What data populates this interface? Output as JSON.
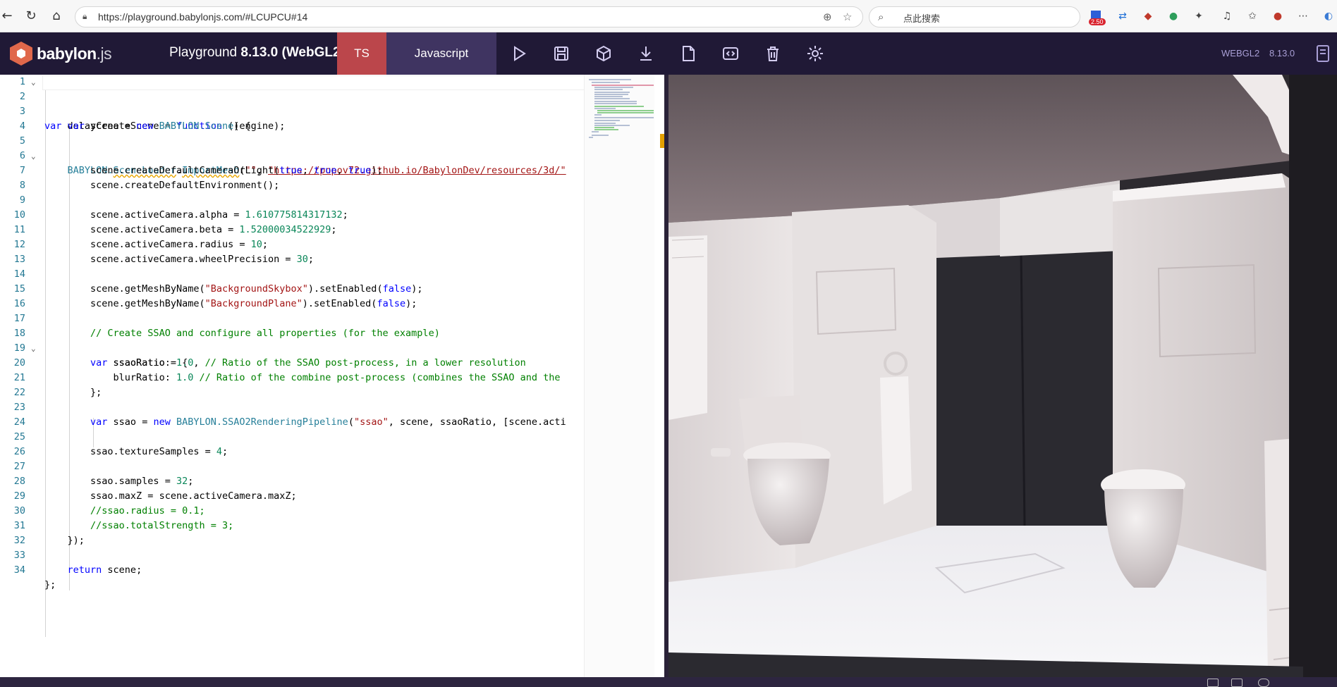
{
  "browser": {
    "url": "https://playground.babylonjs.com/#LCUPCU#14",
    "search_placeholder": "点此搜索",
    "badge": "2.50"
  },
  "app": {
    "logo_main": "babylon",
    "logo_suffix": ".js",
    "title_prefix": "Playground ",
    "title_version": "8.13.0 (WebGL2)",
    "tab_ts": "TS",
    "tab_js": "Javascript",
    "engine_label": "WEBGL2",
    "version_label": "8.13.0",
    "accent": "#bb464b",
    "bar_color": "#201936"
  },
  "editor": {
    "line_numbers": [
      "1",
      "2",
      "3",
      "4",
      "5",
      "6",
      "7",
      "8",
      "9",
      "10",
      "11",
      "12",
      "13",
      "14",
      "15",
      "16",
      "17",
      "18",
      "19",
      "20",
      "21",
      "22",
      "23",
      "24",
      "25",
      "26",
      "27",
      "28",
      "29",
      "30",
      "31",
      "32",
      "33",
      "34"
    ]
  },
  "code": {
    "l1": {
      "kw": "var",
      "rest": " delayCreateScene = ",
      "kw2": "function",
      "tail": " () {"
    },
    "l3": {
      "kw": "var",
      "a": " scene = ",
      "kw2": "new",
      "cls": " BABYLON.Scene",
      "tail": "(engine);"
    },
    "l5": {
      "cls": "BABYLON.",
      "d1": "SceneLoader",
      "dot": ".",
      "d2": "ImportMesh",
      "a": "(",
      "s1": "\"\"",
      "b": ", ",
      "s2": "\"https://popov72.github.io/BabylonDev/resources/3d/\""
    },
    "l6": {
      "a": "scene.createDefaultCameraOrLight(",
      "k1": "true",
      "c1": ", ",
      "k2": "true",
      "c2": ", ",
      "k3": "true",
      "tail": ");"
    },
    "l7": "scene.createDefaultEnvironment();",
    "l9": {
      "a": "scene.activeCamera.alpha = ",
      "n": "1.610775814317132",
      "tail": ";"
    },
    "l10": {
      "a": "scene.activeCamera.beta = ",
      "n": "1.52000034522929",
      "tail": ";"
    },
    "l11": {
      "a": "scene.activeCamera.radius = ",
      "n": "10",
      "tail": ";"
    },
    "l12": {
      "a": "scene.activeCamera.wheelPrecision = ",
      "n": "30",
      "tail": ";"
    },
    "l14": {
      "a": "scene.getMeshByName(",
      "s": "\"BackgroundSkybox\"",
      "b": ").setEnabled(",
      "k": "false",
      "tail": ");"
    },
    "l15": {
      "a": "scene.getMeshByName(",
      "s": "\"BackgroundPlane\"",
      "b": ").setEnabled(",
      "k": "false",
      "tail": ");"
    },
    "l17": "// Create SSAO and configure all properties (for the example)",
    "l18": {
      "kw": "var",
      "tail": " ssaoRatio = {"
    },
    "l19": {
      "a": "ssaoRatio: ",
      "n": "1.0",
      "b": ", ",
      "c": "// Ratio of the SSAO post-process, in a lower resolution"
    },
    "l20": {
      "a": "blurRatio: ",
      "n": "1.0",
      "b": " ",
      "c": "// Ratio of the combine post-process (combines the SSAO and the"
    },
    "l21": "};",
    "l23": {
      "kw": "var",
      "a": " ssao = ",
      "kw2": "new",
      "cls": " BABYLON.SSAO2RenderingPipeline",
      "b": "(",
      "s": "\"ssao\"",
      "tail": ", scene, ssaoRatio, [scene.acti"
    },
    "l25": {
      "a": "ssao.textureSamples = ",
      "n": "4",
      "tail": ";"
    },
    "l27": {
      "a": "ssao.samples = ",
      "n": "32",
      "tail": ";"
    },
    "l28": "ssao.maxZ = scene.activeCamera.maxZ;",
    "l29": "//ssao.radius = 0.1;",
    "l30": "//ssao.totalStrength = 3;",
    "l31": "});",
    "l33": {
      "kw": "return",
      "tail": " scene;"
    },
    "l34": "};"
  }
}
